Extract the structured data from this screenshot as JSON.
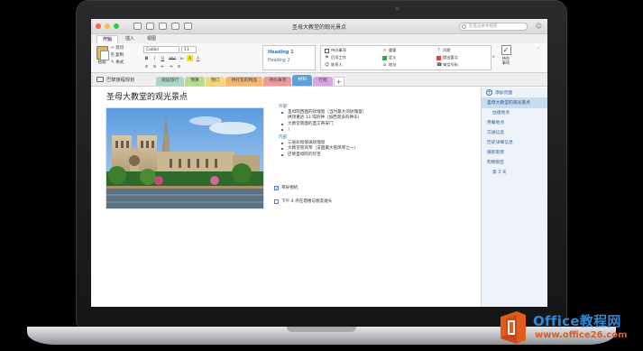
{
  "window": {
    "title": "圣母大教堂的观光景点",
    "search_placeholder": "在笔记本中搜索",
    "smiley": "☺"
  },
  "ribbon_tabs": [
    "开始",
    "插入",
    "视图"
  ],
  "ribbon": {
    "paste_label": "粘贴",
    "clipboard": [
      "剪切",
      "复制",
      "格式"
    ],
    "font_name": "Calibri",
    "font_size": "11",
    "format_buttons": [
      "B",
      "I",
      "U",
      "abc",
      "x₂",
      "A",
      "A"
    ],
    "list_buttons": [
      "≡",
      "≡",
      "⇤",
      "⇥",
      "≡"
    ],
    "heading1": "Heading 1",
    "heading2": "Heading 2",
    "tags": [
      {
        "label": "待办事项",
        "icon": "checkbox-icon",
        "color": "#333333"
      },
      {
        "label": "重要",
        "icon": "star-icon",
        "color": "#e8a21b"
      },
      {
        "label": "问题",
        "icon": "question-icon",
        "color": "#7a3fb4"
      },
      {
        "label": "后续工作",
        "icon": "flag-icon",
        "color": "#2e74b5"
      },
      {
        "label": "定义",
        "icon": "highlight-icon",
        "color": "#3aa64a"
      },
      {
        "label": "提出要点",
        "icon": "highlight-icon",
        "color": "#d04848"
      },
      {
        "label": "联系人",
        "icon": "contact-icon",
        "color": "#555555"
      },
      {
        "label": "地址",
        "icon": "house-icon",
        "color": "#555555"
      },
      {
        "label": "电话号码",
        "icon": "phone-icon",
        "color": "#555555"
      }
    ],
    "todo_label": "待办\n事项"
  },
  "notebook": {
    "name": "巴黎旅程规划"
  },
  "sections": [
    {
      "label": "短途旅行",
      "color": "#a9d7c4"
    },
    {
      "label": "预算",
      "color": "#b7dc8e"
    },
    {
      "label": "预订",
      "color": "#f3d57a"
    },
    {
      "label": "待打包的物品",
      "color": "#f5b66e"
    },
    {
      "label": "待办事项",
      "color": "#ec9b9b"
    },
    {
      "label": "材料",
      "color": "#5aa2d6",
      "active": true
    },
    {
      "label": "行程",
      "color": "#d6a6e2"
    }
  ],
  "page": {
    "title": "圣母大教堂的观光景点",
    "outside_heading": "外部",
    "outside_items": [
      "圣母院西面的玫瑰窗（当时最大的玫瑰窗）",
      "拱顶重达 13 吨的钟（加西莫多的钟乐）",
      "大教堂南面的圣艾蒂安门"
    ],
    "outside_extra": "」",
    "inside_heading": "内部",
    "inside_items": [
      "三层彩绘玻璃玫瑰窗",
      "大教堂管风琴（法国最大管风琴之一）",
      "巴黎圣母院的珍宝"
    ],
    "check_items": [
      {
        "label": "带好相机",
        "checked": true
      },
      {
        "label": "下午 4 点在塔楼与朋友碰头",
        "checked": false
      }
    ]
  },
  "pages_pane": {
    "add_label": "添加页面",
    "pages": [
      "圣母大教堂的观光景点",
      "住宿地点",
      "用餐地点",
      "交通信息",
      "历史详细信息",
      "摄影取景",
      "购物街区",
      "第 3 天"
    ],
    "selected": 0
  },
  "watermark": {
    "name": "Office教程网",
    "url": "www.office26.com"
  },
  "colors": {
    "accent": "#7030a0",
    "link": "#2e74b5",
    "watermark_blue": "#2f88d6",
    "watermark_orange": "#e25a1c"
  }
}
